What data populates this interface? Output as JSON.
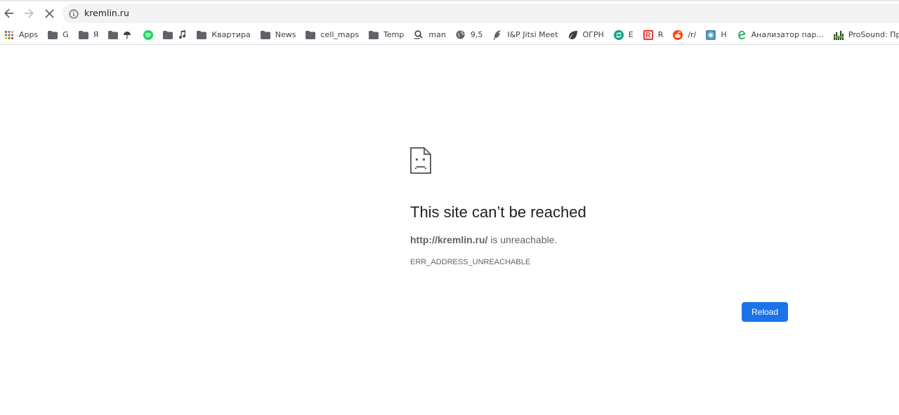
{
  "address_bar": {
    "url": "kremlin.ru"
  },
  "toolbar": {
    "back_icon": "arrow-left-icon",
    "forward_icon": "arrow-right-icon",
    "stop_icon": "close-icon",
    "info_icon": "info-icon"
  },
  "bookmarks": [
    {
      "label": "Apps",
      "icon": "apps-grid-icon"
    },
    {
      "label": "G",
      "icon": "folder-icon"
    },
    {
      "label": "Я",
      "icon": "folder-icon"
    },
    {
      "label": "",
      "icon": "folder-icon"
    },
    {
      "label": "",
      "icon": "umbrella-icon"
    },
    {
      "label": "",
      "icon": "spotify-icon"
    },
    {
      "label": "",
      "icon": "folder-icon"
    },
    {
      "label": "",
      "icon": "music-note-icon"
    },
    {
      "label": "Квартира",
      "icon": "folder-icon"
    },
    {
      "label": "News",
      "icon": "folder-icon"
    },
    {
      "label": "cell_maps",
      "icon": "folder-icon"
    },
    {
      "label": "Temp",
      "icon": "folder-icon"
    },
    {
      "label": "man",
      "icon": "man-page-icon"
    },
    {
      "label": "9,5",
      "icon": "globe-icon"
    },
    {
      "label": "I&P Jitsi Meet",
      "icon": "feather-icon"
    },
    {
      "label": "ОГРН",
      "icon": "leaf-icon"
    },
    {
      "label": "E",
      "icon": "refresh-badge-icon"
    },
    {
      "label": "R",
      "icon": "r-logo-icon"
    },
    {
      "label": "/r/",
      "icon": "reddit-icon"
    },
    {
      "label": "H",
      "icon": "hub-icon"
    },
    {
      "label": "Анализатор пар...",
      "icon": "e-logo-icon"
    },
    {
      "label": "ProSound: Пр",
      "icon": "equalizer-icon"
    }
  ],
  "error_page": {
    "icon": "sad-document-icon",
    "title": "This site can’t be reached",
    "url_bold": "http://kremlin.ru/",
    "desc_suffix": " is unreachable.",
    "code": "ERR_ADDRESS_UNREACHABLE",
    "reload_label": "Reload"
  },
  "colors": {
    "accent": "#1a73e8",
    "title": "#202124",
    "text": "#5f6368"
  }
}
